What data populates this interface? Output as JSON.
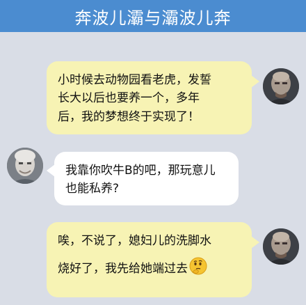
{
  "header": {
    "title": "奔波儿灞与灞波儿奔"
  },
  "messages": [
    {
      "side": "right",
      "lines": [
        "小时候去动物园看老虎，发誓",
        "长大以后也要养一个，多年",
        "后，我的梦想终于实现了！"
      ],
      "avatar_icon": "bald-man-avatar-icon"
    },
    {
      "side": "left",
      "lines": [
        "我靠你吹牛B的吧，那玩意儿",
        "也能私养?"
      ],
      "avatar_icon": "gray-haired-man-avatar-icon"
    },
    {
      "side": "right",
      "lines": [
        "唉，不说了，媳妇儿的洗脚水",
        "烧好了，我先给她端过去"
      ],
      "avatar_icon": "bald-man-avatar-icon",
      "emoji_icon": "thinking-face-icon"
    }
  ],
  "colors": {
    "header_bg": "#4b8cd0",
    "chat_bg": "#d9dde6",
    "bubble_right_bg": "#f7f3b4",
    "bubble_left_bg": "#ffffff"
  }
}
